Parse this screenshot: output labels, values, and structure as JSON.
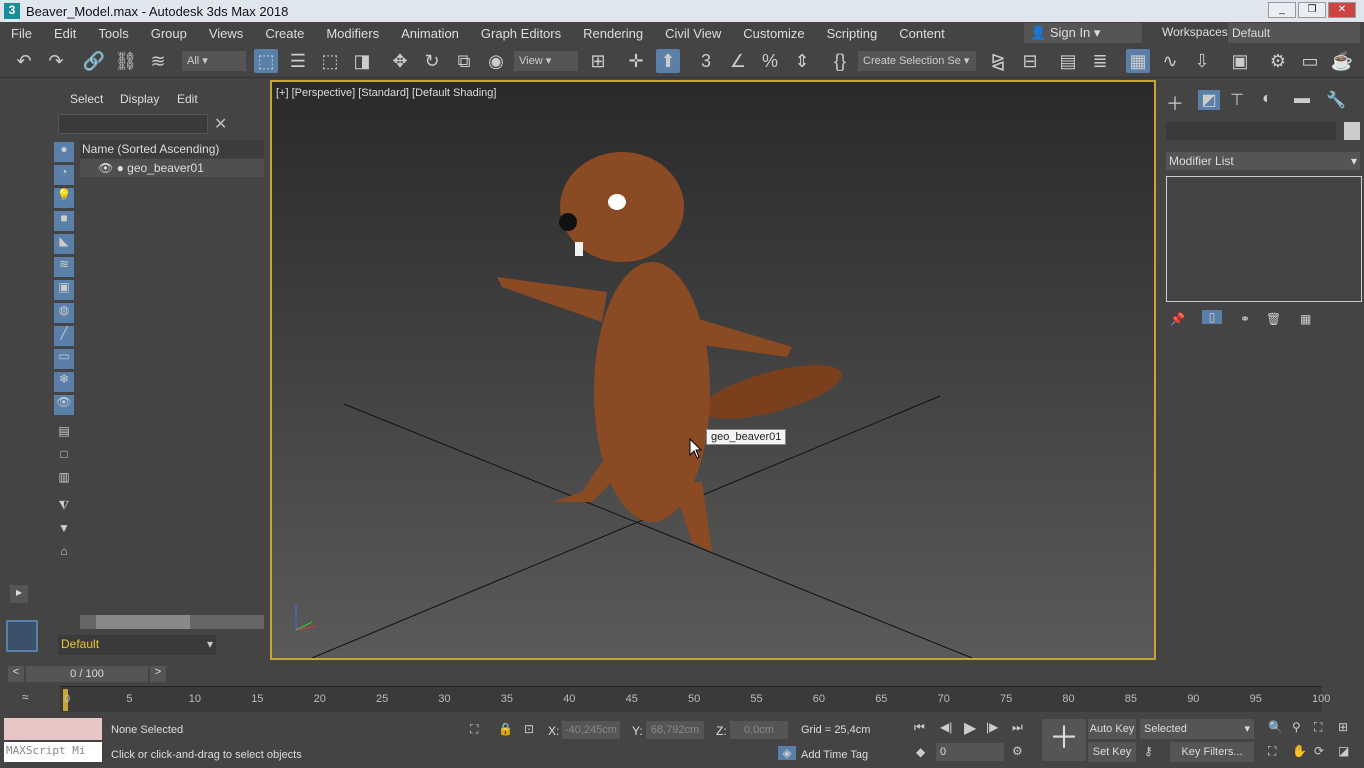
{
  "window": {
    "title": "Beaver_Model.max - Autodesk 3ds Max 2018",
    "app_icon": "3"
  },
  "menu": [
    "File",
    "Edit",
    "Tools",
    "Group",
    "Views",
    "Create",
    "Modifiers",
    "Animation",
    "Graph Editors",
    "Rendering",
    "Civil View",
    "Customize",
    "Scripting",
    "Content"
  ],
  "account": {
    "sign_in": "Sign In",
    "workspaces_label": "Workspaces:",
    "workspace": "Default"
  },
  "toolbar": {
    "filter": "All",
    "ref_coord": "View",
    "named_selection": "Create Selection Se"
  },
  "scene_explorer": {
    "tabs": [
      "Select",
      "Display",
      "Edit"
    ],
    "column": "Name (Sorted Ascending)",
    "items": [
      "geo_beaver01"
    ],
    "layer": "Default"
  },
  "viewport": {
    "label": "[+] [Perspective] [Standard] [Default Shading]",
    "tooltip": "geo_beaver01"
  },
  "command_panel": {
    "modifier_list": "Modifier List"
  },
  "timeline": {
    "frame": "0 / 100",
    "ticks": [
      "0",
      "5",
      "10",
      "15",
      "20",
      "25",
      "30",
      "35",
      "40",
      "45",
      "50",
      "55",
      "60",
      "65",
      "70",
      "75",
      "80",
      "85",
      "90",
      "95",
      "100"
    ]
  },
  "status": {
    "maxscript": "MAXScript Mi",
    "selection": "None Selected",
    "prompt": "Click or click-and-drag to select objects",
    "x_label": "X:",
    "x": "-40,245cm",
    "y_label": "Y:",
    "y": "68,792cm",
    "z_label": "Z:",
    "z": "0,0cm",
    "grid": "Grid = 25,4cm",
    "add_time_tag": "Add Time Tag",
    "auto_key": "Auto Key",
    "set_key": "Set Key",
    "key_mode": "Selected",
    "key_filters": "Key Filters...",
    "frame_input": "0"
  },
  "colors": {
    "accent": "#5a7fa8",
    "viewport_border": "#c8a432",
    "beaver": "#8a4b24"
  }
}
